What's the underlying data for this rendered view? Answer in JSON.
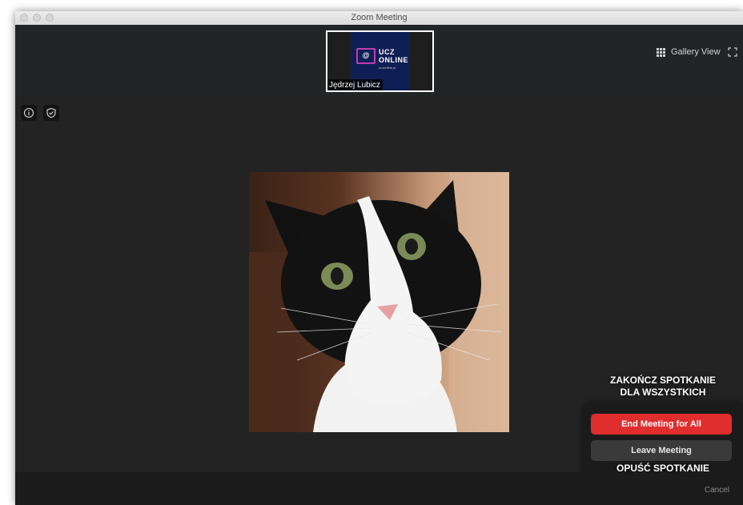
{
  "window": {
    "title": "Zoom Meeting"
  },
  "participant": {
    "name": "Jędrzej Lubicz",
    "logo_line1": "UCZ",
    "logo_line2": "ONLINE",
    "logo_small": "uczonline.pl"
  },
  "header": {
    "gallery_view_label": "Gallery View"
  },
  "captions": {
    "end_all_line1": "ZAKOŃCZ SPOTKANIE",
    "end_all_line2": "DLA WSZYSTKICH",
    "leave": "OPUŚĆ SPOTKANIE"
  },
  "end_menu": {
    "end_for_all_label": "End Meeting for All",
    "leave_label": "Leave Meeting",
    "cancel_label": "Cancel"
  },
  "colors": {
    "end_button": "#e02d2d",
    "leave_button": "#3a3a3a",
    "background": "#232323"
  },
  "icons": [
    "info-icon",
    "shield-check-icon",
    "grid-icon",
    "fullscreen-icon",
    "video-camera-icon"
  ]
}
